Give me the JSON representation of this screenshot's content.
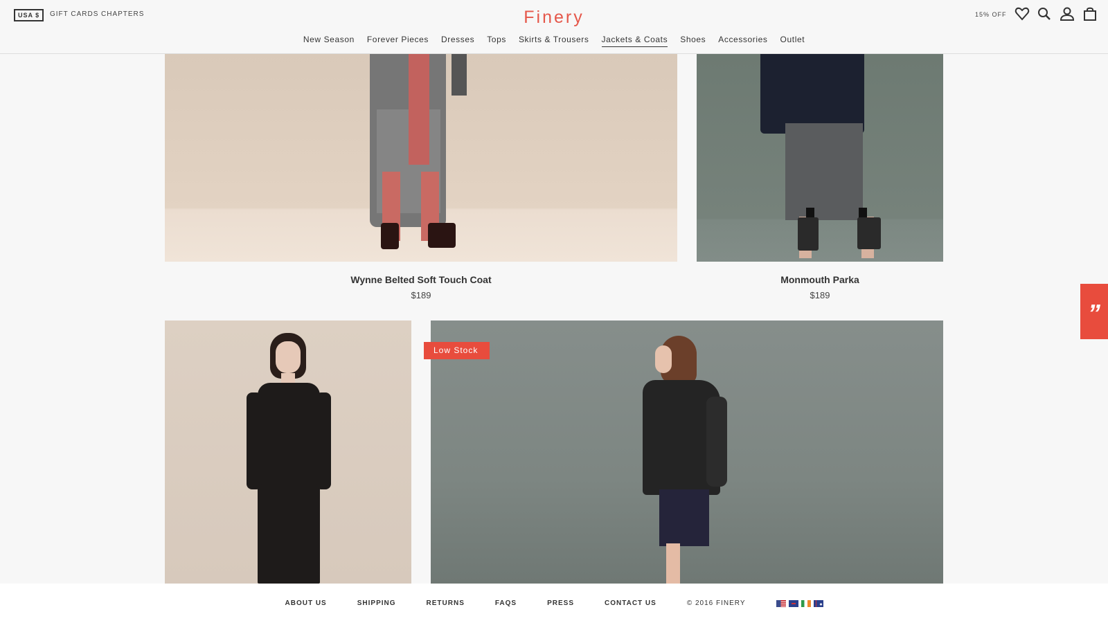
{
  "header": {
    "currency": "USA $",
    "top_links": [
      "GIFT CARDS",
      "CHAPTERS"
    ],
    "logo": "Finery",
    "promo": "15% OFF",
    "icons": [
      "heart-icon",
      "search-icon",
      "account-icon",
      "bag-icon"
    ]
  },
  "nav": {
    "items": [
      "New Season",
      "Forever Pieces",
      "Dresses",
      "Tops",
      "Skirts & Trousers",
      "Jackets & Coats",
      "Shoes",
      "Accessories",
      "Outlet"
    ],
    "active": "Jackets & Coats"
  },
  "products": [
    {
      "name": "Wynne Belted Soft Touch Coat",
      "price": "$189"
    },
    {
      "name": "Monmouth Parka",
      "price": "$189"
    }
  ],
  "badge": "Low Stock",
  "feedback_tab": "”",
  "footer": {
    "links": [
      "ABOUT US",
      "SHIPPING",
      "RETURNS",
      "FAQS",
      "PRESS",
      "CONTACT US"
    ],
    "copyright": "© 2016 FINERY",
    "flags": [
      "us-flag",
      "uk-flag",
      "ireland-flag",
      "australia-flag"
    ]
  },
  "colors": {
    "brand": "#e5574a",
    "badge": "#e84c3d",
    "text": "#333333",
    "background": "#f7f7f7"
  }
}
